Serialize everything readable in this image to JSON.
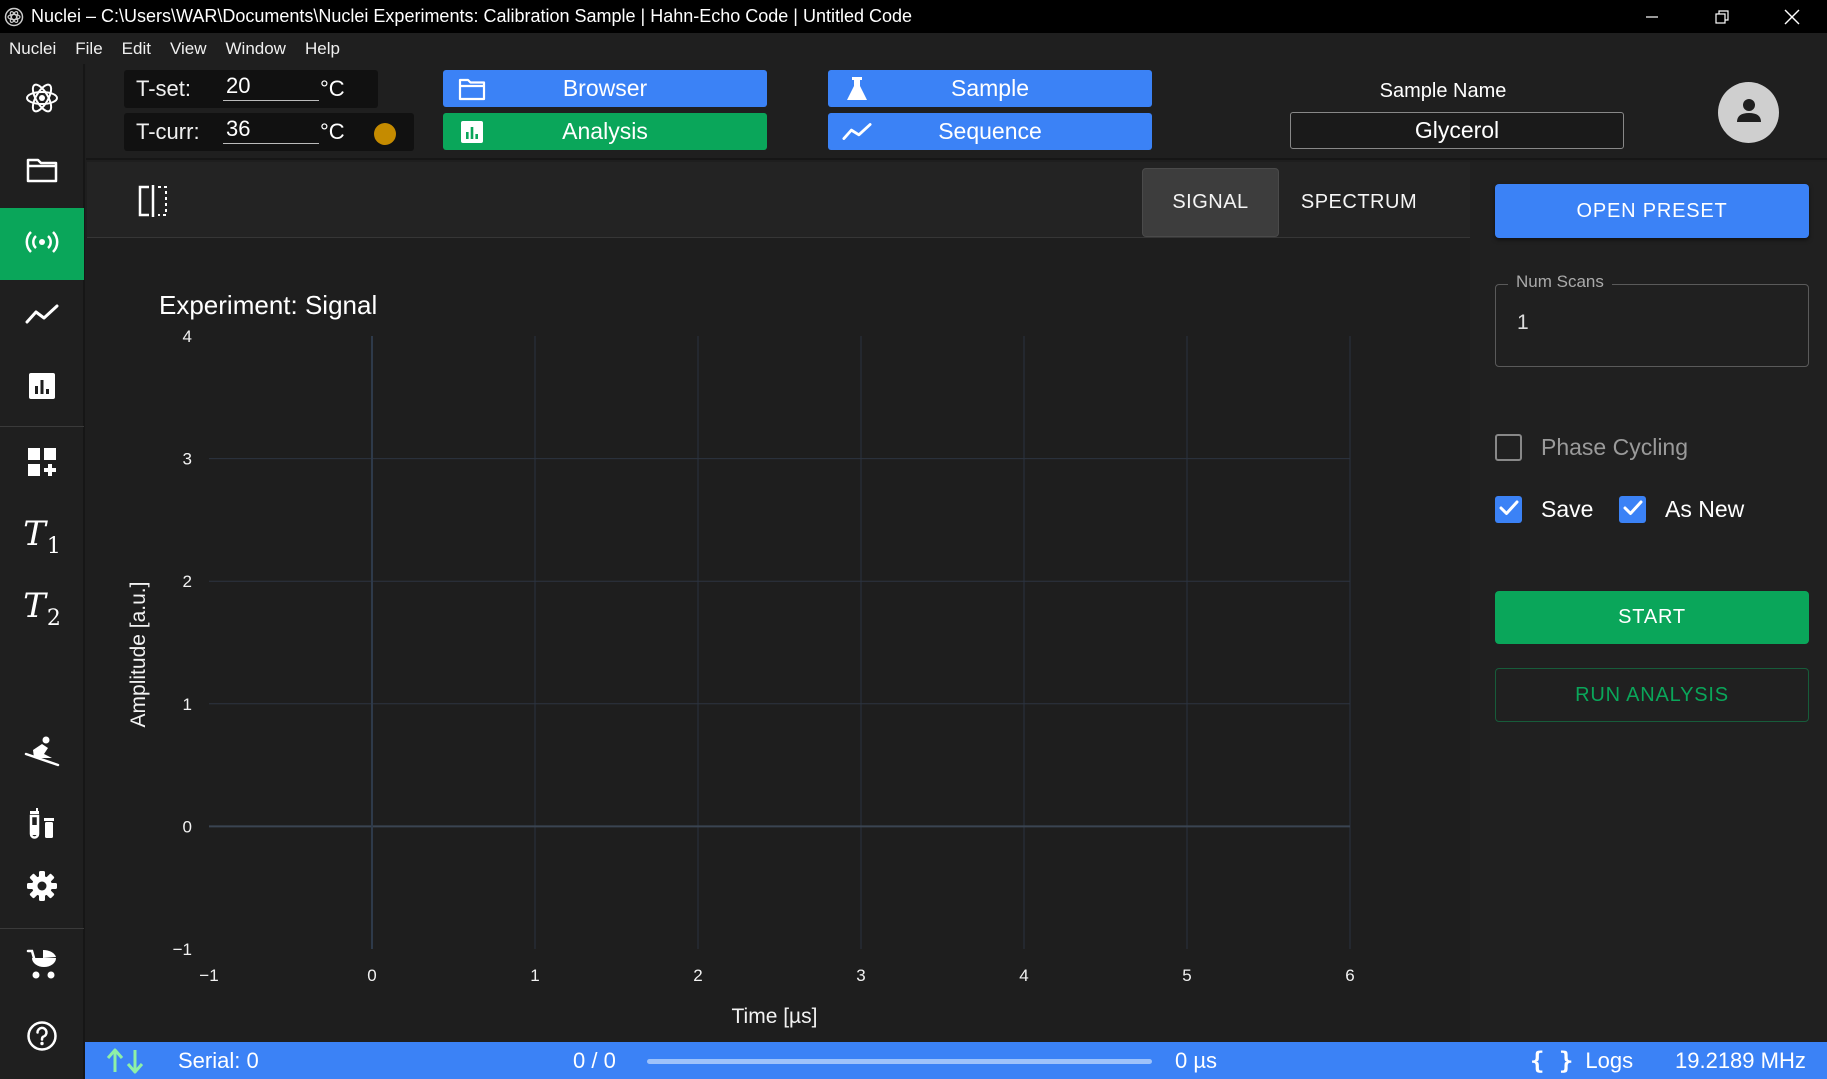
{
  "window": {
    "title": "Nuclei – C:\\Users\\WAR\\Documents\\Nuclei Experiments: Calibration Sample | Hahn-Echo Code | Untitled Code"
  },
  "menu": [
    "Nuclei",
    "File",
    "Edit",
    "View",
    "Window",
    "Help"
  ],
  "sidebar": {
    "items": [
      {
        "icon": "atom-logo-icon"
      },
      {
        "icon": "folder-icon"
      },
      {
        "icon": "signal-icon",
        "active": true
      },
      {
        "icon": "line-chart-icon"
      },
      {
        "icon": "bar-chart-icon"
      },
      {
        "icon": "add-widget-icon"
      },
      {
        "icon": "t1-icon",
        "label": "T",
        "sub": "1"
      },
      {
        "icon": "t2-icon",
        "label": "T",
        "sub": "2"
      },
      {
        "icon": "skiing-icon"
      },
      {
        "icon": "vials-icon"
      },
      {
        "icon": "gear-icon"
      },
      {
        "icon": "baby-carriage-icon"
      },
      {
        "icon": "help-icon"
      }
    ]
  },
  "header": {
    "tset": {
      "label": "T-set:",
      "value": "20",
      "unit": "°C"
    },
    "tcurr": {
      "label": "T-curr:",
      "value": "36",
      "unit": "°C",
      "status_color": "#c58b00"
    },
    "buttons": {
      "browser": "Browser",
      "sample": "Sample",
      "analysis": "Analysis",
      "sequence": "Sequence"
    },
    "sample_name_label": "Sample Name",
    "sample_name_value": "Glycerol"
  },
  "main": {
    "tabs": {
      "signal": "SIGNAL",
      "spectrum": "SPECTRUM"
    },
    "active_tab": "SIGNAL",
    "experiment_title": "Experiment: Signal"
  },
  "chart_data": {
    "type": "line",
    "title": "",
    "xlabel": "Time [µs]",
    "ylabel": "Amplitude [a.u.]",
    "xlim": [
      -1,
      6
    ],
    "ylim": [
      -1,
      4
    ],
    "xticks": [
      -1,
      0,
      1,
      2,
      3,
      4,
      5,
      6
    ],
    "yticks": [
      -1,
      0,
      1,
      2,
      3,
      4
    ],
    "grid": true,
    "series": []
  },
  "rightpanel": {
    "open_preset": "OPEN PRESET",
    "num_scans_label": "Num Scans",
    "num_scans_value": "1",
    "phase_cycling": {
      "label": "Phase Cycling",
      "checked": false
    },
    "save": {
      "label": "Save",
      "checked": true
    },
    "as_new": {
      "label": "As New",
      "checked": true
    },
    "start": "START",
    "run_analysis": "RUN ANALYSIS"
  },
  "statusbar": {
    "serial": "Serial: 0",
    "progress_text": "0 / 0",
    "progress_value": 0,
    "time": "0 µs",
    "logs": "Logs",
    "frequency": "19.2189 MHz"
  },
  "colors": {
    "accent_blue": "#3b82f6",
    "accent_green": "#0aa65a",
    "background": "#1e1e1e"
  }
}
